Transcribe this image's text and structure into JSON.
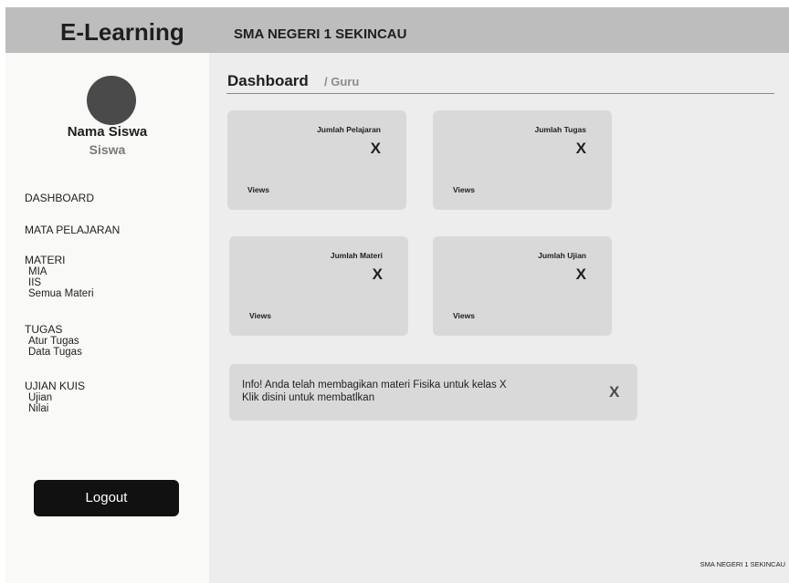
{
  "header": {
    "brand": "E-Learning",
    "school": "SMA NEGERI 1 SEKINCAU"
  },
  "user": {
    "name": "Nama Siswa",
    "role": "Siswa"
  },
  "nav": {
    "dashboard": "DASHBOARD",
    "mata_pelajaran": "MATA PELAJARAN",
    "materi": {
      "label": "MATERI",
      "items": [
        "MIA",
        "IIS",
        "Semua Materi"
      ]
    },
    "tugas": {
      "label": "TUGAS",
      "items": [
        "Atur Tugas",
        "Data Tugas"
      ]
    },
    "ujian": {
      "label": "UJIAN KUIS",
      "items": [
        "Ujian",
        "Nilai"
      ]
    },
    "logout": "Logout"
  },
  "page": {
    "title": "Dashboard",
    "crumb": "/ Guru"
  },
  "cards": [
    {
      "label": "Jumlah Pelajaran",
      "value": "X",
      "link": "Views"
    },
    {
      "label": "Jumlah Tugas",
      "value": "X",
      "link": "Views"
    },
    {
      "label": "Jumlah Materi",
      "value": "X",
      "link": "Views"
    },
    {
      "label": "Jumlah Ujian",
      "value": "X",
      "link": "Views"
    }
  ],
  "info": {
    "line1": "Info! Anda telah membagikan materi Fisika untuk kelas X",
    "line2": "Klik disini untuk membatlkan",
    "close": "X"
  },
  "footer": "SMA NEGERI 1 SEKINCAU"
}
